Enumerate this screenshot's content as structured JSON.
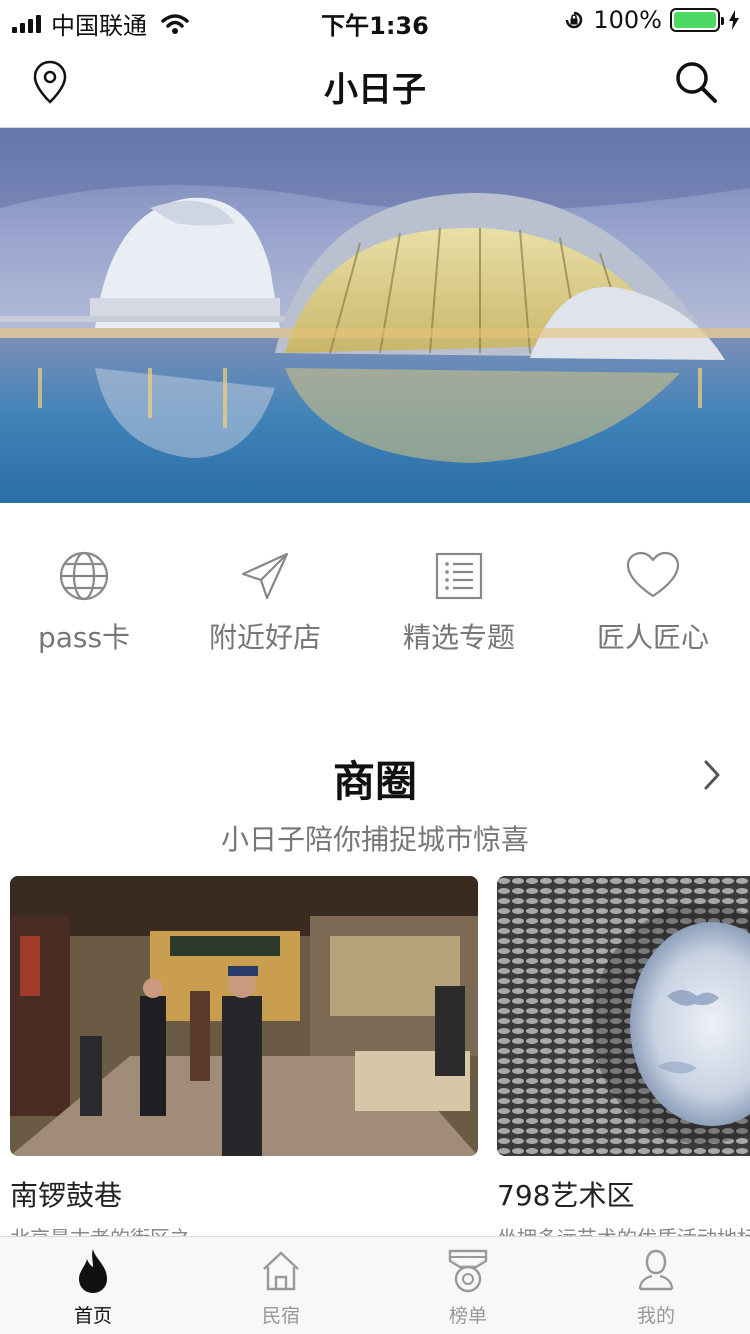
{
  "status_bar": {
    "carrier": "中国联通",
    "time": "下午1:36",
    "battery": "100%",
    "battery_level": 1.0
  },
  "nav": {
    "title": "小日子",
    "left_icon": "location-pin-icon",
    "right_icon": "search-icon"
  },
  "quick_menu": [
    {
      "label": "pass卡",
      "icon": "globe-icon"
    },
    {
      "label": "附近好店",
      "icon": "paper-plane-icon"
    },
    {
      "label": "精选专题",
      "icon": "list-icon"
    },
    {
      "label": "匠人匠心",
      "icon": "heart-icon"
    }
  ],
  "section": {
    "title": "商圈",
    "subtitle": "小日子陪你捕捉城市惊喜"
  },
  "cards": [
    {
      "name": "南锣鼓巷",
      "desc": "北京最古老的街区之一"
    },
    {
      "name": "798艺术区",
      "desc": "坐拥多远艺术的优质活动地标"
    }
  ],
  "tabs": [
    {
      "label": "首页",
      "icon": "flame-icon",
      "active": true
    },
    {
      "label": "民宿",
      "icon": "house-icon",
      "active": false
    },
    {
      "label": "榜单",
      "icon": "medal-icon",
      "active": false
    },
    {
      "label": "我的",
      "icon": "user-icon",
      "active": false
    }
  ],
  "colors": {
    "battery_green": "#4cd964",
    "text_gray": "#777777",
    "tab_active": "#111111",
    "tab_inactive": "#999999"
  }
}
